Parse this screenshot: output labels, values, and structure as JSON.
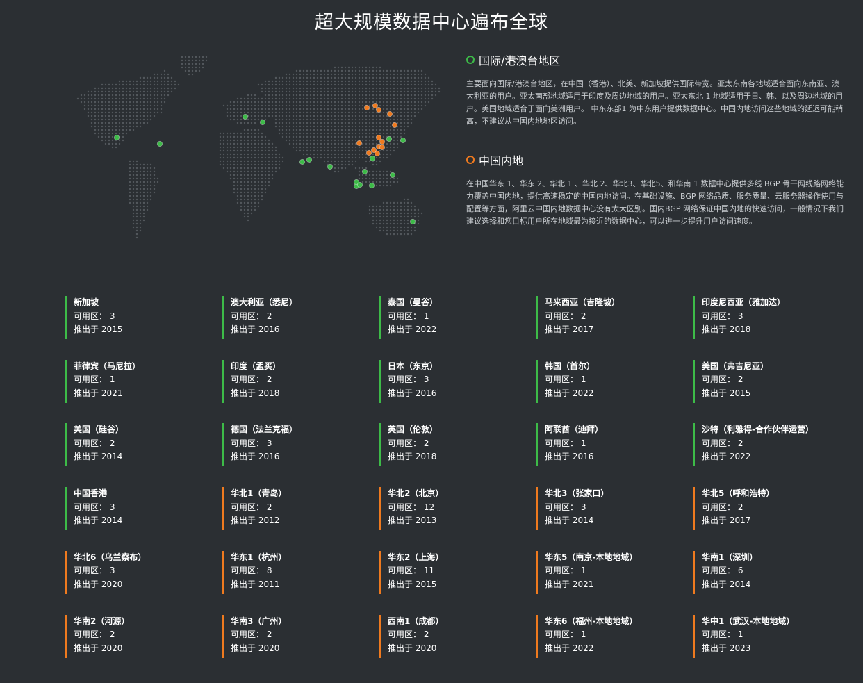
{
  "page": {
    "title": "超大规模数据中心遍布全球"
  },
  "colors": {
    "international": "#3dbb48",
    "mainland": "#ef7a1f",
    "background": "#2b2f33"
  },
  "regions": {
    "international": {
      "heading": "国际/港澳台地区",
      "description": "主要面向国际/港澳台地区，在中国（香港）、北美、新加坡提供国际带宽。亚太东南各地域适合面向东南亚、澳大利亚的用户。亚太南部地域适用于印度及周边地域的用户。亚太东北 1 地域适用于日、韩、以及周边地域的用户。美国地域适合于面向美洲用户。 中东东部1 为中东用户提供数据中心。中国内地访问这些地域的延迟可能稍高，不建议从中国内地地区访问。"
    },
    "mainland": {
      "heading": "中国内地",
      "description": "在中国华东 1、华东 2、华北 1 、华北 2、华北3、华北5、和华南 1 数据中心提供多线 BGP 骨干网线路网络能力覆盖中国内地，提供高速稳定的中国内地访问。在基础设施、BGP 网络品质、服务质量、云服务器操作使用与配置等方面，阿里云中国内地数据中心没有太大区别。国内BGP 网络保证中国内地的快速访问，一般情况下我们建议选择和您目标用户所在地域最为接近的数据中心，可以进一步提升用户访问速度。"
    }
  },
  "cards": [
    {
      "name": "新加坡",
      "zones": "可用区： 3",
      "launched": "推出于 2015",
      "type": "international"
    },
    {
      "name": "澳大利亚（悉尼）",
      "zones": "可用区： 2",
      "launched": "推出于 2016",
      "type": "international"
    },
    {
      "name": "泰国（曼谷）",
      "zones": "可用区： 1",
      "launched": "推出于 2022",
      "type": "international"
    },
    {
      "name": "马来西亚（吉隆坡）",
      "zones": "可用区： 2",
      "launched": "推出于 2017",
      "type": "international"
    },
    {
      "name": "印度尼西亚（雅加达）",
      "zones": "可用区： 3",
      "launched": "推出于 2018",
      "type": "international"
    },
    {
      "name": "菲律宾（马尼拉）",
      "zones": "可用区： 1",
      "launched": "推出于 2021",
      "type": "international"
    },
    {
      "name": "印度（孟买）",
      "zones": "可用区： 2",
      "launched": "推出于 2018",
      "type": "international"
    },
    {
      "name": "日本（东京）",
      "zones": "可用区： 3",
      "launched": "推出于 2016",
      "type": "international"
    },
    {
      "name": "韩国（首尔）",
      "zones": "可用区： 1",
      "launched": "推出于 2022",
      "type": "international"
    },
    {
      "name": "美国（弗吉尼亚）",
      "zones": "可用区： 2",
      "launched": "推出于 2015",
      "type": "international"
    },
    {
      "name": "美国（硅谷）",
      "zones": "可用区： 2",
      "launched": "推出于 2014",
      "type": "international"
    },
    {
      "name": "德国（法兰克福）",
      "zones": "可用区： 3",
      "launched": "推出于 2016",
      "type": "international"
    },
    {
      "name": "英国（伦敦）",
      "zones": "可用区： 2",
      "launched": "推出于 2018",
      "type": "international"
    },
    {
      "name": "阿联酋（迪拜）",
      "zones": "可用区： 1",
      "launched": "推出于 2016",
      "type": "international"
    },
    {
      "name": "沙特（利雅得-合作伙伴运营）",
      "zones": "可用区： 2",
      "launched": "推出于 2022",
      "type": "international"
    },
    {
      "name": "中国香港",
      "zones": "可用区： 3",
      "launched": "推出于 2014",
      "type": "international"
    },
    {
      "name": "华北1（青岛）",
      "zones": "可用区： 2",
      "launched": "推出于 2012",
      "type": "mainland"
    },
    {
      "name": "华北2（北京）",
      "zones": "可用区： 12",
      "launched": "推出于 2013",
      "type": "mainland"
    },
    {
      "name": "华北3（张家口）",
      "zones": "可用区： 3",
      "launched": "推出于 2014",
      "type": "mainland"
    },
    {
      "name": "华北5（呼和浩特）",
      "zones": "可用区： 2",
      "launched": "推出于 2017",
      "type": "mainland"
    },
    {
      "name": "华北6（乌兰察布）",
      "zones": "可用区： 3",
      "launched": "推出于 2020",
      "type": "mainland"
    },
    {
      "name": "华东1（杭州）",
      "zones": "可用区： 8",
      "launched": "推出于 2011",
      "type": "mainland"
    },
    {
      "name": "华东2（上海）",
      "zones": "可用区： 11",
      "launched": "推出于 2015",
      "type": "mainland"
    },
    {
      "name": "华东5（南京-本地地域）",
      "zones": "可用区： 1",
      "launched": "推出于 2021",
      "type": "mainland"
    },
    {
      "name": "华南1（深圳）",
      "zones": "可用区： 6",
      "launched": "推出于 2014",
      "type": "mainland"
    },
    {
      "name": "华南2（河源）",
      "zones": "可用区： 2",
      "launched": "推出于 2020",
      "type": "mainland"
    },
    {
      "name": "华南3（广州）",
      "zones": "可用区： 2",
      "launched": "推出于 2020",
      "type": "mainland"
    },
    {
      "name": "西南1（成都）",
      "zones": "可用区： 2",
      "launched": "推出于 2020",
      "type": "mainland"
    },
    {
      "name": "华东6（福州-本地地域）",
      "zones": "可用区： 1",
      "launched": "推出于 2022",
      "type": "mainland"
    },
    {
      "name": "华中1（武汉-本地地域）",
      "zones": "可用区： 1",
      "launched": "推出于 2023",
      "type": "mainland"
    }
  ]
}
